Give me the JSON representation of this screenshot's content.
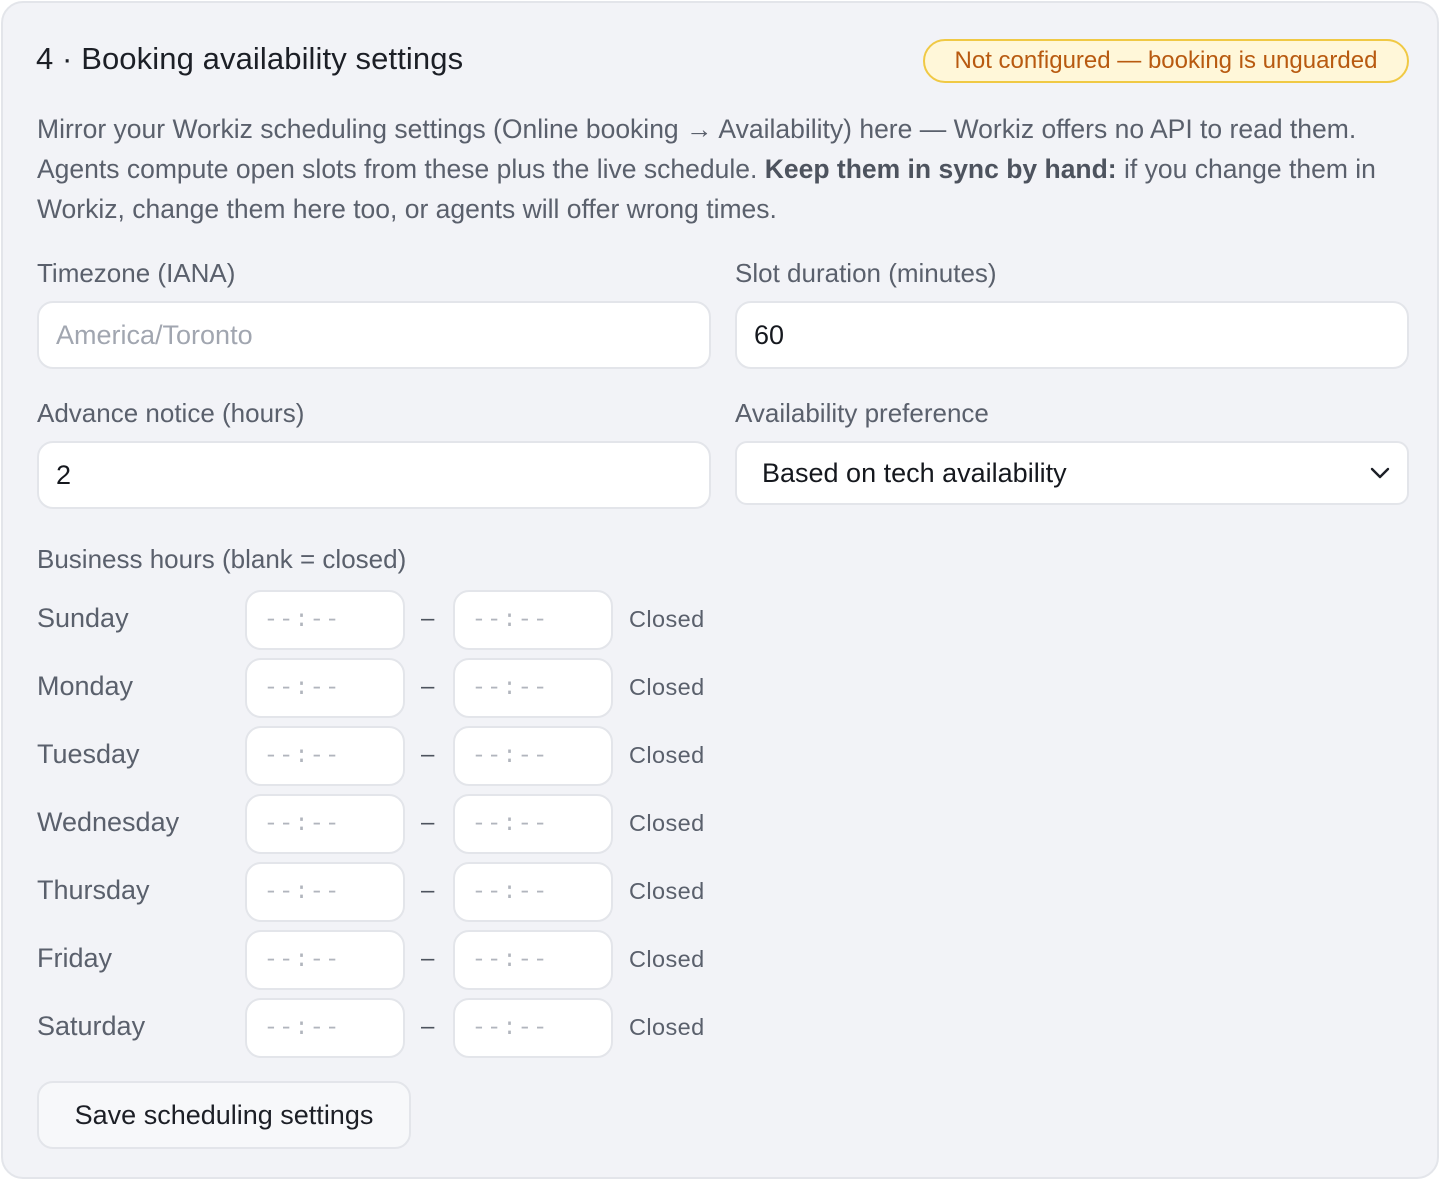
{
  "section": {
    "title": "4 · Booking availability settings",
    "status_badge": "Not configured — booking is unguarded",
    "description_intro": "Mirror your Workiz scheduling settings (Online booking → Availability) here — Workiz offers no API to read them. Agents compute open slots from these plus the live schedule.",
    "description_bold": "Keep them in sync by hand:",
    "description_outro": "if you change them in Workiz, change them here too, or agents will offer wrong times."
  },
  "fields": {
    "timezone": {
      "label": "Timezone (IANA)",
      "value": "",
      "placeholder": "America/Toronto"
    },
    "slot_duration": {
      "label": "Slot duration (minutes)",
      "value": "60"
    },
    "advance_notice": {
      "label": "Advance notice (hours)",
      "value": "2"
    },
    "availability_preference": {
      "label": "Availability preference",
      "selected": "Based on tech availability"
    }
  },
  "business_hours": {
    "label": "Business hours (blank = closed)",
    "time_placeholder": "--:--",
    "separator": "–",
    "days": [
      {
        "name": "Sunday",
        "status": "Closed"
      },
      {
        "name": "Monday",
        "status": "Closed"
      },
      {
        "name": "Tuesday",
        "status": "Closed"
      },
      {
        "name": "Wednesday",
        "status": "Closed"
      },
      {
        "name": "Thursday",
        "status": "Closed"
      },
      {
        "name": "Friday",
        "status": "Closed"
      },
      {
        "name": "Saturday",
        "status": "Closed"
      }
    ]
  },
  "actions": {
    "save_label": "Save scheduling settings"
  },
  "colors": {
    "badge_bg": "#fff7d9",
    "badge_border": "#f0c944",
    "badge_text": "#b85a10",
    "card_bg": "#f2f3f7"
  }
}
